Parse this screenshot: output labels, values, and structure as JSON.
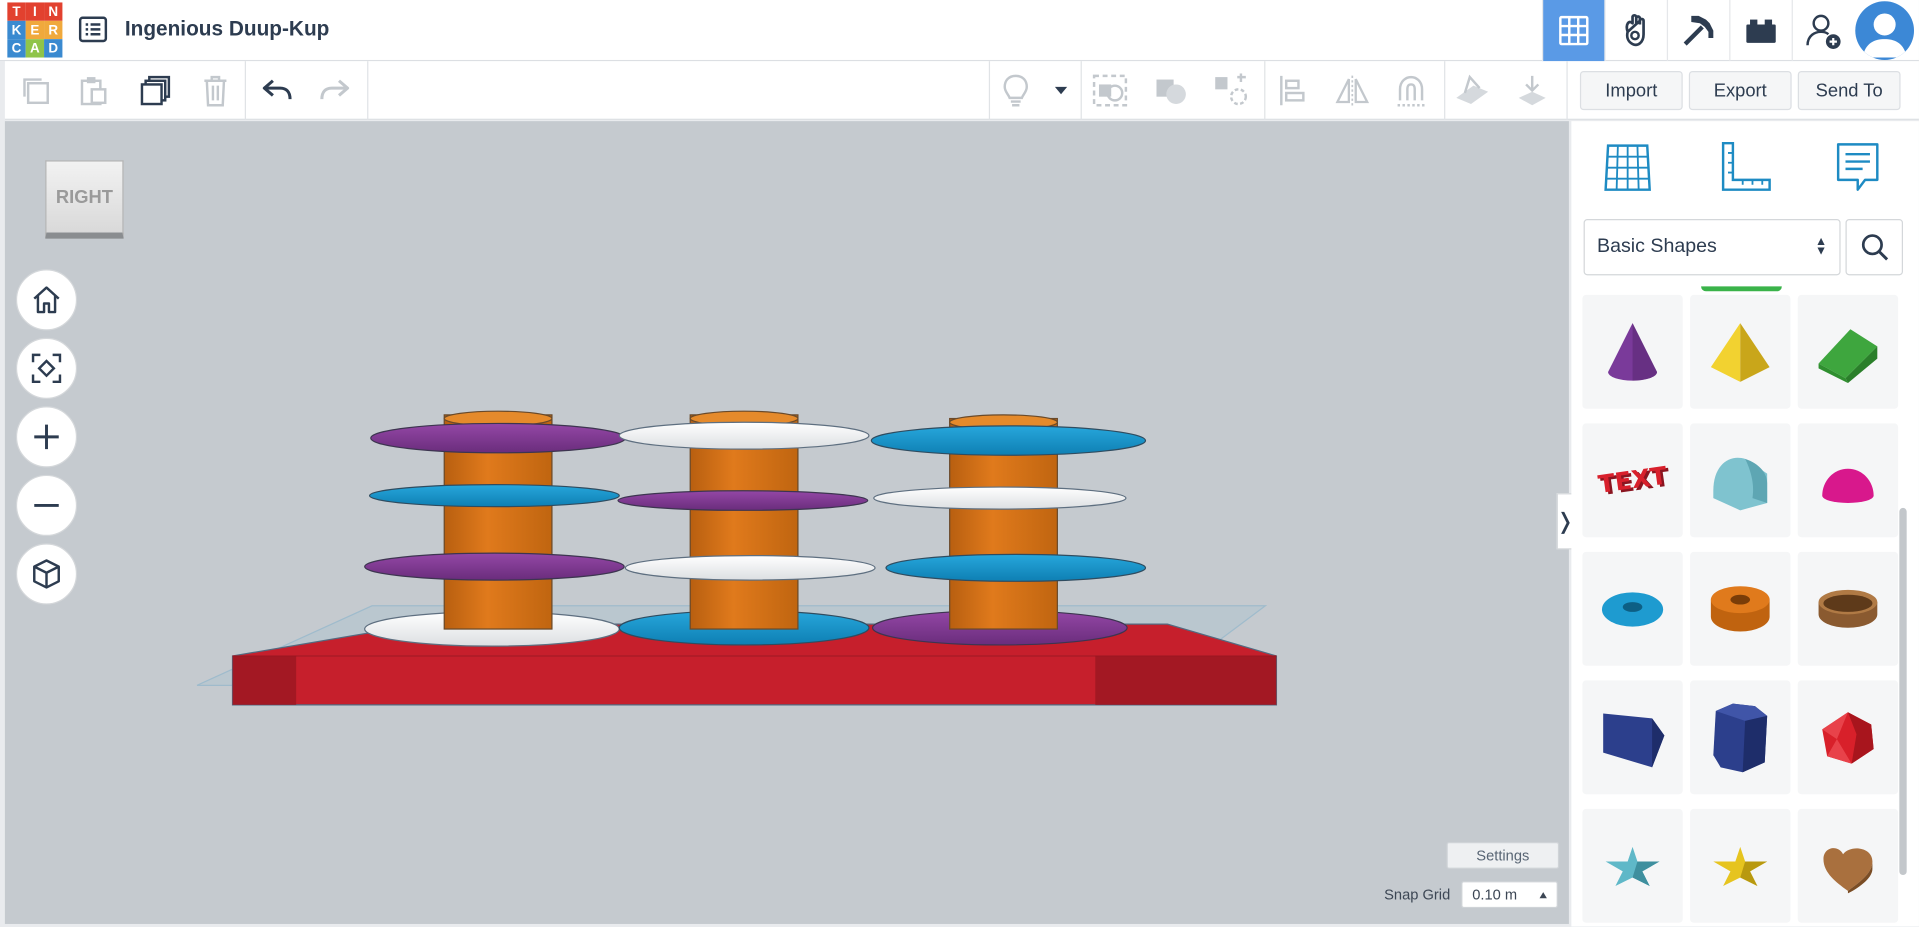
{
  "app": {
    "logo_letters": [
      "T",
      "I",
      "N",
      "K",
      "E",
      "R",
      "C",
      "A",
      "D"
    ],
    "logo_colors": [
      "#e2412f",
      "#e2412f",
      "#e2412f",
      "#3a8ad0",
      "#f0a93c",
      "#f0a93c",
      "#3a8ad0",
      "#8fc449",
      "#3a8ad0"
    ],
    "title": "Ingenious Duup-Kup"
  },
  "header": {
    "buttons": [
      {
        "name": "3d-design-view-button",
        "icon": "grid-icon",
        "active": true
      },
      {
        "name": "circuits-view-button",
        "icon": "hand-icon",
        "active": false
      },
      {
        "name": "minecraft-view-button",
        "icon": "pickaxe-icon",
        "active": false
      },
      {
        "name": "bricks-view-button",
        "icon": "brick-icon",
        "active": false
      },
      {
        "name": "invite-user-button",
        "icon": "add-user-icon",
        "active": false
      }
    ]
  },
  "toolbar": {
    "import_label": "Import",
    "export_label": "Export",
    "send_to_label": "Send To"
  },
  "viewport": {
    "viewcube_label": "RIGHT",
    "settings_label": "Settings",
    "snap_grid_label": "Snap Grid",
    "snap_grid_value": "0.10 m"
  },
  "panel": {
    "category_selected": "Basic Shapes",
    "shapes": [
      {
        "name": "cone",
        "color": "#7a3a9a"
      },
      {
        "name": "pyramid",
        "color": "#e6c41f"
      },
      {
        "name": "roof",
        "color": "#3ea63e"
      },
      {
        "name": "text",
        "color": "#c8202c"
      },
      {
        "name": "half-cylinder",
        "color": "#7fc3cf"
      },
      {
        "name": "half-sphere",
        "color": "#d8188c"
      },
      {
        "name": "torus",
        "color": "#1e9bd0"
      },
      {
        "name": "tube",
        "color": "#e07a1c"
      },
      {
        "name": "ring",
        "color": "#a9703e"
      },
      {
        "name": "wedge-polygon",
        "color": "#2c3f8c"
      },
      {
        "name": "hexagonal-prism",
        "color": "#2c3f8c"
      },
      {
        "name": "icosahedron",
        "color": "#d8202a"
      },
      {
        "name": "star",
        "color": "#5fb8c8"
      },
      {
        "name": "star-gold",
        "color": "#e6c41f"
      },
      {
        "name": "heart",
        "color": "#a9703e"
      }
    ]
  },
  "colors": {
    "accent": "#5a9ae6",
    "viewport_bg": "#c5cacf"
  }
}
